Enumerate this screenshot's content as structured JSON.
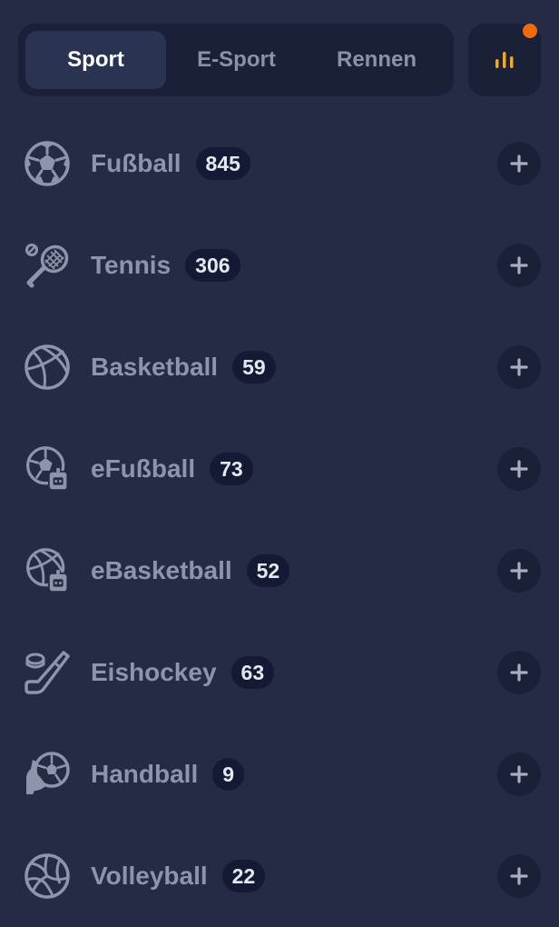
{
  "tabs": [
    {
      "label": "Sport",
      "active": true
    },
    {
      "label": "E-Sport",
      "active": false
    },
    {
      "label": "Rennen",
      "active": false
    }
  ],
  "stats_button": {
    "icon": "bar-chart-icon",
    "accent_color": "#f5a623",
    "notification_dot_color": "#f06a0c"
  },
  "sports": [
    {
      "name": "Fußball",
      "count": "845",
      "icon": "soccer-ball-icon"
    },
    {
      "name": "Tennis",
      "count": "306",
      "icon": "tennis-racket-icon"
    },
    {
      "name": "Basketball",
      "count": "59",
      "icon": "basketball-icon"
    },
    {
      "name": "eFußball",
      "count": "73",
      "icon": "efootball-icon"
    },
    {
      "name": "eBasketball",
      "count": "52",
      "icon": "ebasketball-icon"
    },
    {
      "name": "Eishockey",
      "count": "63",
      "icon": "hockey-stick-icon"
    },
    {
      "name": "Handball",
      "count": "9",
      "icon": "handball-icon"
    },
    {
      "name": "Volleyball",
      "count": "22",
      "icon": "volleyball-icon"
    }
  ]
}
